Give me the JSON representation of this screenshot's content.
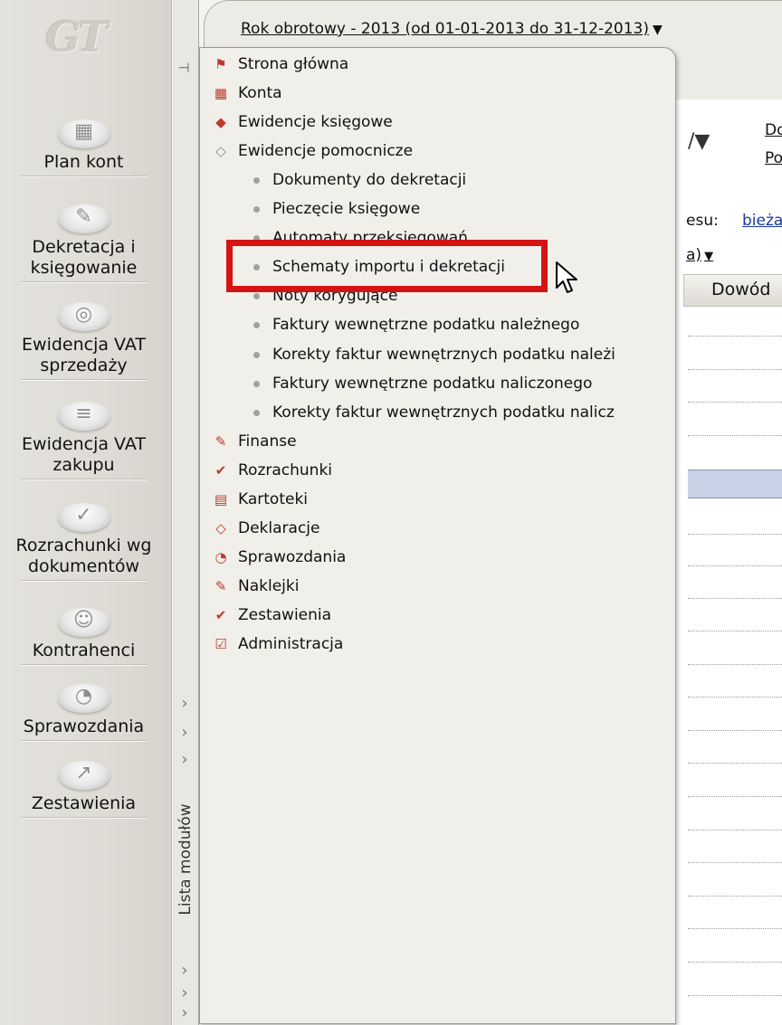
{
  "window": {
    "year_label": "Rok obrotowy - 2013  (od 01-01-2013 do 31-12-2013)",
    "year_arrow": "▼"
  },
  "left_bar": {
    "logo": "GT",
    "modules": [
      {
        "label_line1": "",
        "label_line2": "Plan kont",
        "icon": "grid-cubes-icon",
        "glyph": "▦"
      },
      {
        "label_line1": "Dekretacja i",
        "label_line2": "księgowanie",
        "icon": "pen-icon",
        "glyph": "✎"
      },
      {
        "label_line1": "Ewidencja VAT",
        "label_line2": "sprzedaży",
        "icon": "coins-icon",
        "glyph": "◎"
      },
      {
        "label_line1": "Ewidencja VAT",
        "label_line2": "zakupu",
        "icon": "books-icon",
        "glyph": "≡"
      },
      {
        "label_line1": "Rozrachunki wg",
        "label_line2": "dokumentów",
        "icon": "check-doc-icon",
        "glyph": "✓"
      },
      {
        "label_line1": "",
        "label_line2": "Kontrahenci",
        "icon": "person-icon",
        "glyph": "☺"
      },
      {
        "label_line1": "",
        "label_line2": "Sprawozdania",
        "icon": "pie-icon",
        "glyph": "◔"
      },
      {
        "label_line1": "",
        "label_line2": "Zestawienia",
        "icon": "chart-line-icon",
        "glyph": "↗"
      }
    ]
  },
  "strip": {
    "label": "Lista modułów",
    "chevron": "›"
  },
  "menu": {
    "items": [
      {
        "type": "top",
        "label": "Strona główna",
        "icon": "flag-icon",
        "glyph": "⚑",
        "color": "#c0392b"
      },
      {
        "type": "top",
        "label": "Konta",
        "icon": "accounts-icon",
        "glyph": "▦",
        "color": "#c0392b"
      },
      {
        "type": "top",
        "label": "Ewidencje księgowe",
        "icon": "ledger-icon",
        "glyph": "◆",
        "color": "#c0392b"
      },
      {
        "type": "top",
        "label": "Ewidencje pomocnicze",
        "icon": "ledger-gray-icon",
        "glyph": "◇",
        "color": "#888888"
      },
      {
        "type": "sub",
        "label": "Dokumenty do dekretacji"
      },
      {
        "type": "sub",
        "label": "Pieczęcie księgowe"
      },
      {
        "type": "sub",
        "label": "Automaty przeksięgowań"
      },
      {
        "type": "sub",
        "label": "Schematy importu i dekretacji"
      },
      {
        "type": "sub",
        "label": "Noty korygujące"
      },
      {
        "type": "sub",
        "label": "Faktury wewnętrzne podatku należnego"
      },
      {
        "type": "sub",
        "label": "Korekty faktur wewnętrznych podatku należi"
      },
      {
        "type": "sub",
        "label": "Faktury wewnętrzne podatku naliczonego"
      },
      {
        "type": "sub",
        "label": "Korekty faktur wewnętrznych podatku nalicz"
      },
      {
        "type": "top",
        "label": "Finanse",
        "icon": "pen-red-icon",
        "glyph": "✎",
        "color": "#c0392b"
      },
      {
        "type": "top",
        "label": "Rozrachunki",
        "icon": "check-red-icon",
        "glyph": "✔",
        "color": "#c0392b"
      },
      {
        "type": "top",
        "label": "Kartoteki",
        "icon": "cards-icon",
        "glyph": "▤",
        "color": "#c0392b"
      },
      {
        "type": "top",
        "label": "Deklaracje",
        "icon": "declaration-icon",
        "glyph": "◇",
        "color": "#c0392b"
      },
      {
        "type": "top",
        "label": "Sprawozdania",
        "icon": "report-pie-icon",
        "glyph": "◔",
        "color": "#c0392b"
      },
      {
        "type": "top",
        "label": "Naklejki",
        "icon": "sticker-icon",
        "glyph": "✎",
        "color": "#c0392b"
      },
      {
        "type": "top",
        "label": "Zestawienia",
        "icon": "chart-red-icon",
        "glyph": "✔",
        "color": "#c0392b"
      },
      {
        "type": "top",
        "label": "Administracja",
        "icon": "admin-icon",
        "glyph": "☑",
        "color": "#c0392b"
      }
    ]
  },
  "background": {
    "link_do": "Do",
    "link_po": "Po",
    "partial_esu": "esu:",
    "link_bieza": "bieża",
    "partial_a": "a)",
    "dropdown_arrow": "▼",
    "slash_glyph": "/▼",
    "column_dowod": "Dowód"
  },
  "highlight_color": "#d41313"
}
